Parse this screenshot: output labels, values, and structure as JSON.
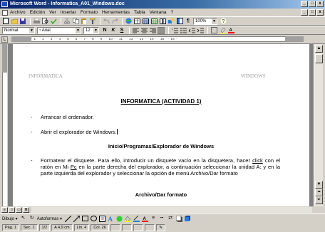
{
  "window": {
    "title": "Microsoft Word - Informatica_A01_Windows.doc",
    "controls": [
      "_",
      "□",
      "x"
    ]
  },
  "menu": {
    "items": [
      "Archivo",
      "Edición",
      "Ver",
      "Insertar",
      "Formato",
      "Herramientas",
      "Tabla",
      "Ventana",
      "?"
    ]
  },
  "toolbar_standard": {
    "zoom": "100%"
  },
  "toolbar_format": {
    "style": "Normal",
    "font": "Arial",
    "size": "12",
    "bold": "N",
    "italic": "K",
    "underline": "S"
  },
  "document": {
    "header_left": "INFORMATICA",
    "header_right": "WINDOWS",
    "title": "INFORMATICA (ACTIVIDAD 1)",
    "bullet_1": "Arrancar el ordenador.",
    "bullet_2": "Abrir el explorador de Windows.",
    "heading_1": "Inicio/Programas/Explorador de Windows",
    "bullet_3_part1": "Formatear el disquete. Para ello, introducir un disquete vacío en la disquetera, hacer ",
    "bullet_3_link1": "click",
    "bullet_3_part2": " con el ratón en Mi ",
    "bullet_3_link2": "Pc",
    "bullet_3_part3": " en la parte derecha del explorador, a continuación seleccionar la unidad A: y en la parte izquierda del explorador y seleccionar la opción de menú Archivo/Dar formato",
    "heading_2": "Archivo/Dar formato",
    "bullet_marker": "-"
  },
  "drawing_toolbar": {
    "draw_label": "Dibujo",
    "autoshapes_label": "Autoformas"
  },
  "status": {
    "page": "Pág. 1",
    "section": "Sec. 1",
    "pages": "1/2",
    "position": "A 4,9 cm",
    "line": "Lín. 4",
    "column": "Col. 26"
  }
}
